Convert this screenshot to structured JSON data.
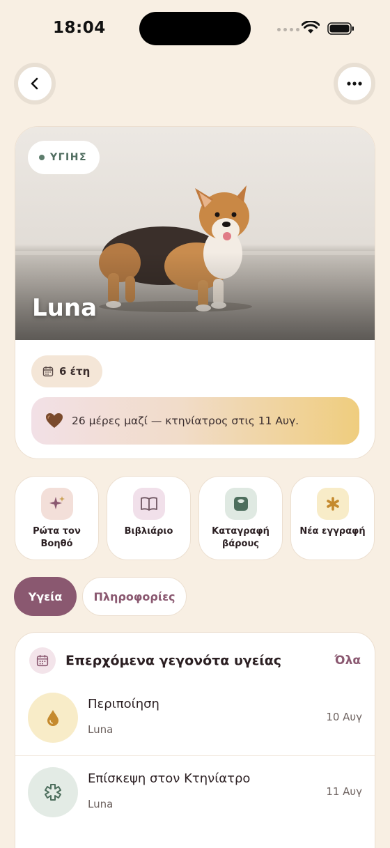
{
  "status_bar": {
    "time": "18:04"
  },
  "pet": {
    "name": "Luna",
    "status": "ΥΓΙΗΣ",
    "age": "6 έτη",
    "banner": "26 μέρες μαζί — κτηνίατρος στις 11 Αυγ."
  },
  "actions": [
    {
      "label": "Ρώτα τον Βοηθό",
      "icon": "sparkles-icon",
      "bg": "#f3dfd9"
    },
    {
      "label": "Βιβλιάριο",
      "icon": "book-icon",
      "bg": "#f1e0ea"
    },
    {
      "label": "Καταγραφή βάρους",
      "icon": "scale-icon",
      "bg": "#dfe9e2"
    },
    {
      "label": "Νέα εγγραφή",
      "icon": "asterisk-icon",
      "bg": "#f8ecc8"
    }
  ],
  "tabs": {
    "active": "Υγεία",
    "inactive": "Πληροφορίες"
  },
  "events": {
    "title": "Επερχόμενα γεγονότα υγείας",
    "all_label": "Όλα",
    "items": [
      {
        "title": "Περιποίηση",
        "pet": "Luna",
        "date": "10 Αυγ",
        "icon": "drop-icon",
        "bg": "#f8ecc8"
      },
      {
        "title": "Επίσκεψη στον Κτηνίατρο",
        "pet": "Luna",
        "date": "11 Αυγ",
        "icon": "medical-icon",
        "bg": "#e3ebe5"
      }
    ]
  },
  "colors": {
    "background": "#f8efe3",
    "accent": "#8a5870",
    "healthy": "#5e7d6d"
  }
}
